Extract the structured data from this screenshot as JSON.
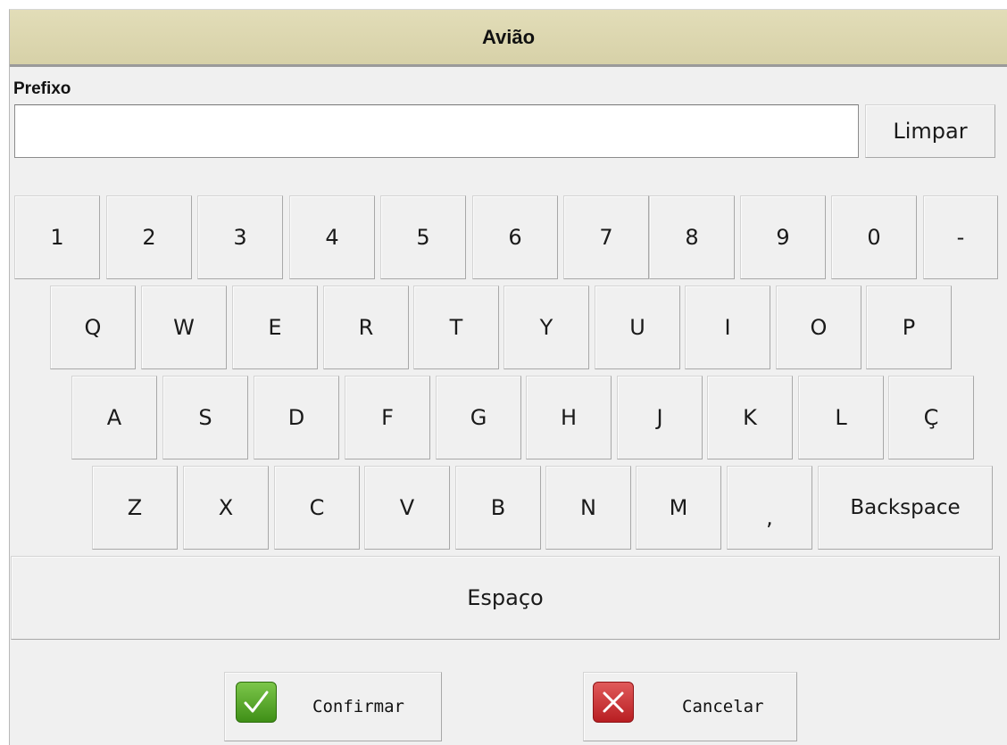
{
  "window": {
    "title": "Avião"
  },
  "prefix": {
    "label": "Prefixo",
    "value": "",
    "clear_label": "Limpar"
  },
  "keyboard": {
    "row1": [
      "1",
      "2",
      "3",
      "4",
      "5",
      "6",
      "7",
      "8",
      "9",
      "0",
      "-"
    ],
    "row2": [
      "Q",
      "W",
      "E",
      "R",
      "T",
      "Y",
      "U",
      "I",
      "O",
      "P"
    ],
    "row3": [
      "A",
      "S",
      "D",
      "F",
      "G",
      "H",
      "J",
      "K",
      "L",
      "Ç"
    ],
    "row4": [
      "Z",
      "X",
      "C",
      "V",
      "B",
      "N",
      "M",
      ","
    ],
    "backspace_label": "Backspace",
    "space_label": "Espaço"
  },
  "actions": {
    "confirm_label": "Confirmar",
    "confirm_icon": "checkmark-icon",
    "confirm_color": "#3f8f17",
    "cancel_label": "Cancelar",
    "cancel_icon": "x-icon",
    "cancel_color": "#c0282a"
  },
  "colors": {
    "titlebar": "#ddd8b2",
    "window_bg": "#f0f0f0"
  }
}
